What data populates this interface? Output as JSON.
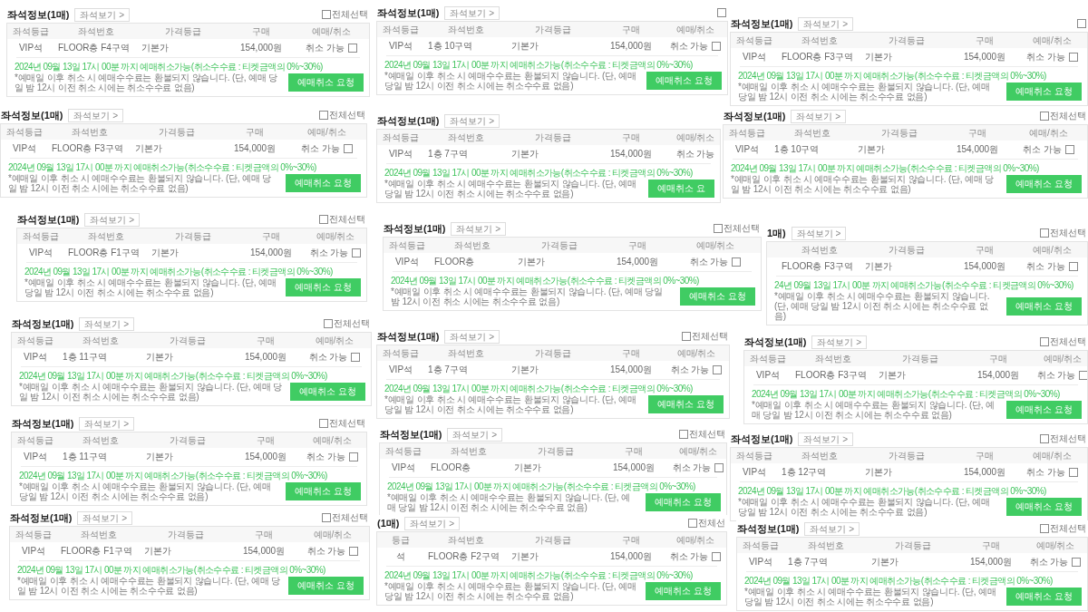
{
  "panels": [
    {
      "title": "좌석정보(1매)",
      "view_button": "좌석보기 >",
      "select_all": {
        "label": "전체선택",
        "checked": false
      },
      "columns": [
        "좌석등급",
        "좌석번호",
        "가격등급",
        "구매",
        "예매/취소"
      ],
      "row": {
        "cells": [
          "VIP석",
          "FLOOR층 F4구역",
          "기본가",
          "154,000원"
        ],
        "status": "취소 가능",
        "checked": false
      },
      "deadline": "2024년 09월 13일 17시 00분 까지 예매취소가능(취소수수료 : 티켓금액의 0%~30%)",
      "note": "*예매일 이후 취소 시 예매수수료는 환불되지 않습니다. (단, 예매 당일 밤 12시 이전 취소 시에는 취소수수료 없음)",
      "cancel_button": "예매취소 요청"
    },
    {
      "title": "좌석정보(1매)",
      "view_button": "좌석보기 >",
      "select_all": {
        "label": "전체선택",
        "checked": false
      },
      "columns": [
        "좌석등급",
        "좌석번호",
        "가격등급",
        "구매",
        "예매/취소"
      ],
      "row": {
        "cells": [
          "VIP석",
          "FLOOR층 F3구역",
          "기본가",
          "154,000원"
        ],
        "status": "취소 가능",
        "checked": false
      },
      "deadline": "2024년 09월 13일 17시 00분 까지 예매취소가능(취소수수료 : 티켓금액의 0%~30%)",
      "note": "*예매일 이후 취소 시 예매수수료는 환불되지 않습니다. (단, 예매 당일 밤 12시 이전 취소 시에는 취소수수료 없음)",
      "cancel_button": "예매취소 요청"
    },
    {
      "title": "좌석정보(1매)",
      "view_button": "좌석보기 >",
      "select_all": {
        "label": "전체선택",
        "checked": false
      },
      "columns": [
        "좌석등급",
        "좌석번호",
        "가격등급",
        "구매",
        "예매/취소"
      ],
      "row": {
        "cells": [
          "VIP석",
          "FLOOR층 F1구역",
          "기본가",
          "154,000원"
        ],
        "status": "취소 가능",
        "checked": false
      },
      "deadline": "2024년 09월 13일 17시 00분 까지 예매취소가능(취소수수료 : 티켓금액의 0%~30%)",
      "note": "*예매일 이후 취소 시 예매수수료는 환불되지 않습니다. (단, 예매 당일 밤 12시 이전 취소 시에는 취소수수료 없음)",
      "cancel_button": "예매취소 요청"
    },
    {
      "title": "좌석정보(1매)",
      "view_button": "좌석보기 >",
      "select_all": {
        "label": "전체선택",
        "checked": false
      },
      "columns": [
        "좌석등급",
        "좌석번호",
        "가격등급",
        "구매",
        "예매/취소"
      ],
      "row": {
        "cells": [
          "VIP석",
          "1층 11구역",
          "기본가",
          "154,000원"
        ],
        "status": "취소 가능",
        "checked": false
      },
      "deadline": "2024년 09월 13일 17시 00분 까지 예매취소가능(취소수수료 : 티켓금액의 0%~30%)",
      "note": "*예매일 이후 취소 시 예매수수료는 환불되지 않습니다. (단, 예매 당일 밤 12시 이전 취소 시에는 취소수수료 없음)",
      "cancel_button": "예매취소 요청"
    },
    {
      "title": "좌석정보(1매)",
      "view_button": "좌석보기 >",
      "select_all": {
        "label": "전체선택",
        "checked": false
      },
      "columns": [
        "좌석등급",
        "좌석번호",
        "가격등급",
        "구매",
        "예매/취소"
      ],
      "row": {
        "cells": [
          "VIP석",
          "1층 11구역",
          "기본가",
          "154,000원"
        ],
        "status": "취소 가능",
        "checked": false
      },
      "deadline": "2024년 09월 13일 17시 00분 까지 예매취소가능(취소수수료 : 티켓금액의 0%~30%)",
      "note": "*예매일 이후 취소 시 예매수수료는 환불되지 않습니다. (단, 예매 당일 밤 12시 이전 취소 시에는 취소수수료 없음)",
      "cancel_button": "예매취소 요청"
    },
    {
      "title": "좌석정보(1매)",
      "view_button": "좌석보기 >",
      "select_all": {
        "label": "전체선택",
        "checked": false
      },
      "columns": [
        "좌석등급",
        "좌석번호",
        "가격등급",
        "구매",
        "예매/취소"
      ],
      "row": {
        "cells": [
          "VIP석",
          "FLOOR층 F1구역",
          "기본가",
          "154,000원"
        ],
        "status": "취소 가능",
        "checked": false
      },
      "deadline": "2024년 09월 13일 17시 00분 까지 예매취소가능(취소수수료 : 티켓금액의 0%~30%)",
      "note": "*예매일 이후 취소 시 예매수수료는 환불되지 않습니다. (단, 예매 당일 밤 12시 이전 취소 시에는 취소수수료 없음)",
      "cancel_button": "예매취소 요청"
    },
    {
      "title": "좌석정보(1매)",
      "view_button": "좌석보기 >",
      "select_all": {
        "checked": false
      },
      "columns": [
        "좌석등급",
        "좌석번호",
        "가격등급",
        "구매",
        "예매/취소"
      ],
      "row": {
        "cells": [
          "VIP석",
          "1층 10구역",
          "기본가",
          "154,000원"
        ],
        "status": "취소 가능",
        "checked": false
      },
      "deadline": "2024년 09월 13일 17시 00분 까지 예매취소가능(취소수수료 : 티켓금액의 0%~30%)",
      "note": "*예매일 이후 취소 시 예매수수료는 환불되지 않습니다. (단, 예매 당일 밤 12시 이전 취소 시에는 취소수수료 없음)",
      "cancel_button": "예매취소 요청"
    },
    {
      "title": "좌석정보(1매)",
      "view_button": "좌석보기 >",
      "columns": [
        "좌석등급",
        "좌석번호",
        "가격등급",
        "구매",
        "예매/취소"
      ],
      "row": {
        "cells": [
          "VIP석",
          "1층 7구역",
          "기본가",
          "154,000원"
        ],
        "status": "취소 가능"
      },
      "deadline": "2024년 09월 13일 17시 00분 까지 예매취소가능(취소수수료 : 티켓금액의 0%~30%)",
      "note": "*예매일 이후 취소 시 예매수수료는 환불되지 않습니다. (단, 예매 당일 밤 12시 이전 취소 시에는 취소수수료 없음)",
      "cancel_button": "예매취소 요"
    },
    {
      "title": "좌석정보(1매)",
      "view_button": "좌석보기 >",
      "select_all": {
        "label": "전체선택",
        "checked": false
      },
      "columns": [
        "좌석등급",
        "좌석번호",
        "가격등급",
        "구매",
        "예매/취소"
      ],
      "row": {
        "cells": [
          "VIP석",
          "FLOOR층",
          "기본가",
          "154,000원"
        ],
        "status": "취소 가능",
        "checked": false
      },
      "deadline": "2024년 09월 13일 17시 00분 까지 예매취소가능(취소수수료 : 티켓금액의 0%~30%)",
      "note": "*예매일 이후 취소 시 예매수수료는 환불되지 않습니다. (단, 예매 당일 밤 12시 이전 취소 시에는 취소수수료 없음)",
      "cancel_button": "예매취소 요청"
    },
    {
      "title": "좌석정보(1매)",
      "view_button": "좌석보기 >",
      "select_all": {
        "label": "전체선택",
        "checked": false
      },
      "columns": [
        "좌석등급",
        "좌석번호",
        "가격등급",
        "구매",
        "예매/취소"
      ],
      "row": {
        "cells": [
          "VIP석",
          "1층 7구역",
          "기본가",
          "154,000원"
        ],
        "status": "취소 가능",
        "checked": false
      },
      "deadline": "2024년 09월 13일 17시 00분 까지 예매취소가능(취소수수료 : 티켓금액의 0%~30%)",
      "note": "*예매일 이후 취소 시 예매수수료는 환불되지 않습니다. (단, 예매 당일 밤 12시 이전 취소 시에는 취소수수료 없음)",
      "cancel_button": "예매취소 요청"
    },
    {
      "title": "좌석정보(1매)",
      "view_button": "좌석보기 >",
      "select_all": {
        "label": "전체선택",
        "checked": false
      },
      "columns": [
        "좌석등급",
        "좌석번호",
        "가격등급",
        "구매",
        "예매/취소"
      ],
      "row": {
        "cells": [
          "VIP석",
          "FLOOR층",
          "기본가",
          "154,000원"
        ],
        "status": "취소 가능",
        "checked": false
      },
      "deadline": "2024년 09월 13일 17시 00분 까지 예매취소가능(취소수수료 : 티켓금액의 0%~30%)",
      "note": "*예매일 이후 취소 시 예매수수료는 환불되지 않습니다. (단, 예매 당일 밤 12시 이전 취소 시에는 취소수수료 없음)",
      "cancel_button": "예매취소 요청"
    },
    {
      "title": "(1매)",
      "view_button": "좌석보기 >",
      "select_all": {
        "label": "전체선",
        "checked": false
      },
      "columns": [
        "등급",
        "좌석번호",
        "가격등급",
        "구매",
        "예매/취소"
      ],
      "row": {
        "cells": [
          "석",
          "FLOOR층 F2구역",
          "기본가",
          "154,000원"
        ],
        "status": "취소 가능",
        "checked": false
      },
      "deadline": "2024년 09월 13일 17시 00분 까지 예매취소가능(취소수수료 : 티켓금액의 0%~30%)",
      "note": "*예매일 이후 취소 시 예매수수료는 환불되지 않습니다. (단, 예매 당일 밤 12시 이전 취소 시에는 취소수수료 없음)",
      "cancel_button": "예매취소 요청"
    },
    {
      "title": "좌석정보(1매)",
      "view_button": "좌석보기 >",
      "select_all": {
        "checked": false
      },
      "columns": [
        "좌석등급",
        "좌석번호",
        "가격등급",
        "구매",
        "예매/취소"
      ],
      "row": {
        "cells": [
          "VIP석",
          "FLOOR층 F3구역",
          "기본가",
          "154,000원"
        ],
        "status": "취소 가능",
        "checked": false
      },
      "deadline": "2024년 09월 13일 17시 00분 까지 예매취소가능(취소수수료 : 티켓금액의 0%~30%)",
      "note": "*예매일 이후 취소 시 예매수수료는 환불되지 않습니다. (단, 예매 당일 밤 12시 이전 취소 시에는 취소수수료 없음)",
      "cancel_button": "예매취소 요청"
    },
    {
      "title": "좌석정보(1매)",
      "view_button": "좌석보기 >",
      "select_all": {
        "label": "전체선택",
        "checked": false
      },
      "columns": [
        "좌석등급",
        "좌석번호",
        "가격등급",
        "구매",
        "예매/취소"
      ],
      "row": {
        "cells": [
          "VIP석",
          "1층 10구역",
          "기본가",
          "154,000원"
        ],
        "status": "취소 가능",
        "checked": false
      },
      "deadline": "2024년 09월 13일 17시 00분 까지 예매취소가능(취소수수료 : 티켓금액의 0%~30%)",
      "note": "*예매일 이후 취소 시 예매수수료는 환불되지 않습니다. (단, 예매 당일 밤 12시 이전 취소 시에는 취소수수료 없음)",
      "cancel_button": "예매취소 요청"
    },
    {
      "title": "1매)",
      "view_button": "좌석보기 >",
      "select_all": {
        "label": "전체선택",
        "checked": false
      },
      "columns": [
        "좌석번호",
        "가격등급",
        "구매",
        "예매/취소"
      ],
      "row": {
        "cells": [
          "FLOOR층 F3구역",
          "기본가",
          "154,000원"
        ],
        "status": "취소 가능",
        "checked": false
      },
      "deadline": "24년 09월 13일 17시 00분 까지 예매취소가능(취소수수료 : 티켓금액의 0%~30%)",
      "note": "*예매일 이후 취소 시 예매수수료는 환불되지 않습니다. (단, 예매 당일 밤 12시 이전 취소 시에는 취소수수료 없음)",
      "cancel_button": "예매취소 요청"
    },
    {
      "title": "좌석정보(1매)",
      "view_button": "좌석보기 >",
      "select_all": {
        "label": "전체선택",
        "checked": false
      },
      "columns": [
        "좌석등급",
        "좌석번호",
        "가격등급",
        "구매",
        "예매/취소"
      ],
      "row": {
        "cells": [
          "VIP석",
          "FLOOR층 F3구역",
          "기본가",
          "154,000원"
        ],
        "status": "취소 가능",
        "checked": false
      },
      "deadline": "2024년 09월 13일 17시 00분 까지 예매취소가능(취소수수료 : 티켓금액의 0%~30%)",
      "note": "*예매일 이후 취소 시 예매수수료는 환불되지 않습니다. (단, 예매 당일 밤 12시 이전 취소 시에는 취소수수료 없음)",
      "cancel_button": "예매취소 요청"
    },
    {
      "title": "좌석정보(1매)",
      "view_button": "좌석보기 >",
      "select_all": {
        "label": "전체선택",
        "checked": false
      },
      "columns": [
        "좌석등급",
        "좌석번호",
        "가격등급",
        "구매",
        "예매/취소"
      ],
      "row": {
        "cells": [
          "VIP석",
          "1층 12구역",
          "기본가",
          "154,000원"
        ],
        "status": "취소 가능",
        "checked": false
      },
      "deadline": "2024년 09월 13일 17시 00분 까지 예매취소가능(취소수수료 : 티켓금액의 0%~30%)",
      "note": "*예매일 이후 취소 시 예매수수료는 환불되지 않습니다. (단, 예매 당일 밤 12시 이전 취소 시에는 취소수수료 없음)",
      "cancel_button": "예매취소 요청"
    },
    {
      "title": "좌석정보(1매)",
      "view_button": "좌석보기 >",
      "select_all": {
        "label": "전체선택",
        "checked": false
      },
      "columns": [
        "좌석등급",
        "좌석번호",
        "가격등급",
        "구매",
        "예매/취소"
      ],
      "row": {
        "cells": [
          "VIP석",
          "1층 7구역",
          "기본가",
          "154,000원"
        ],
        "status": "취소 가능",
        "checked": false
      },
      "deadline": "2024년 09월 13일 17시 00분 까지 예매취소가능(취소수수료 : 티켓금액의 0%~30%)",
      "note": "*예매일 이후 취소 시 예매수수료는 환불되지 않습니다. (단, 예매 당일 밤 12시 이전 취소 시에는 취소수수료 없음)",
      "cancel_button": "예매취소 요청"
    }
  ]
}
